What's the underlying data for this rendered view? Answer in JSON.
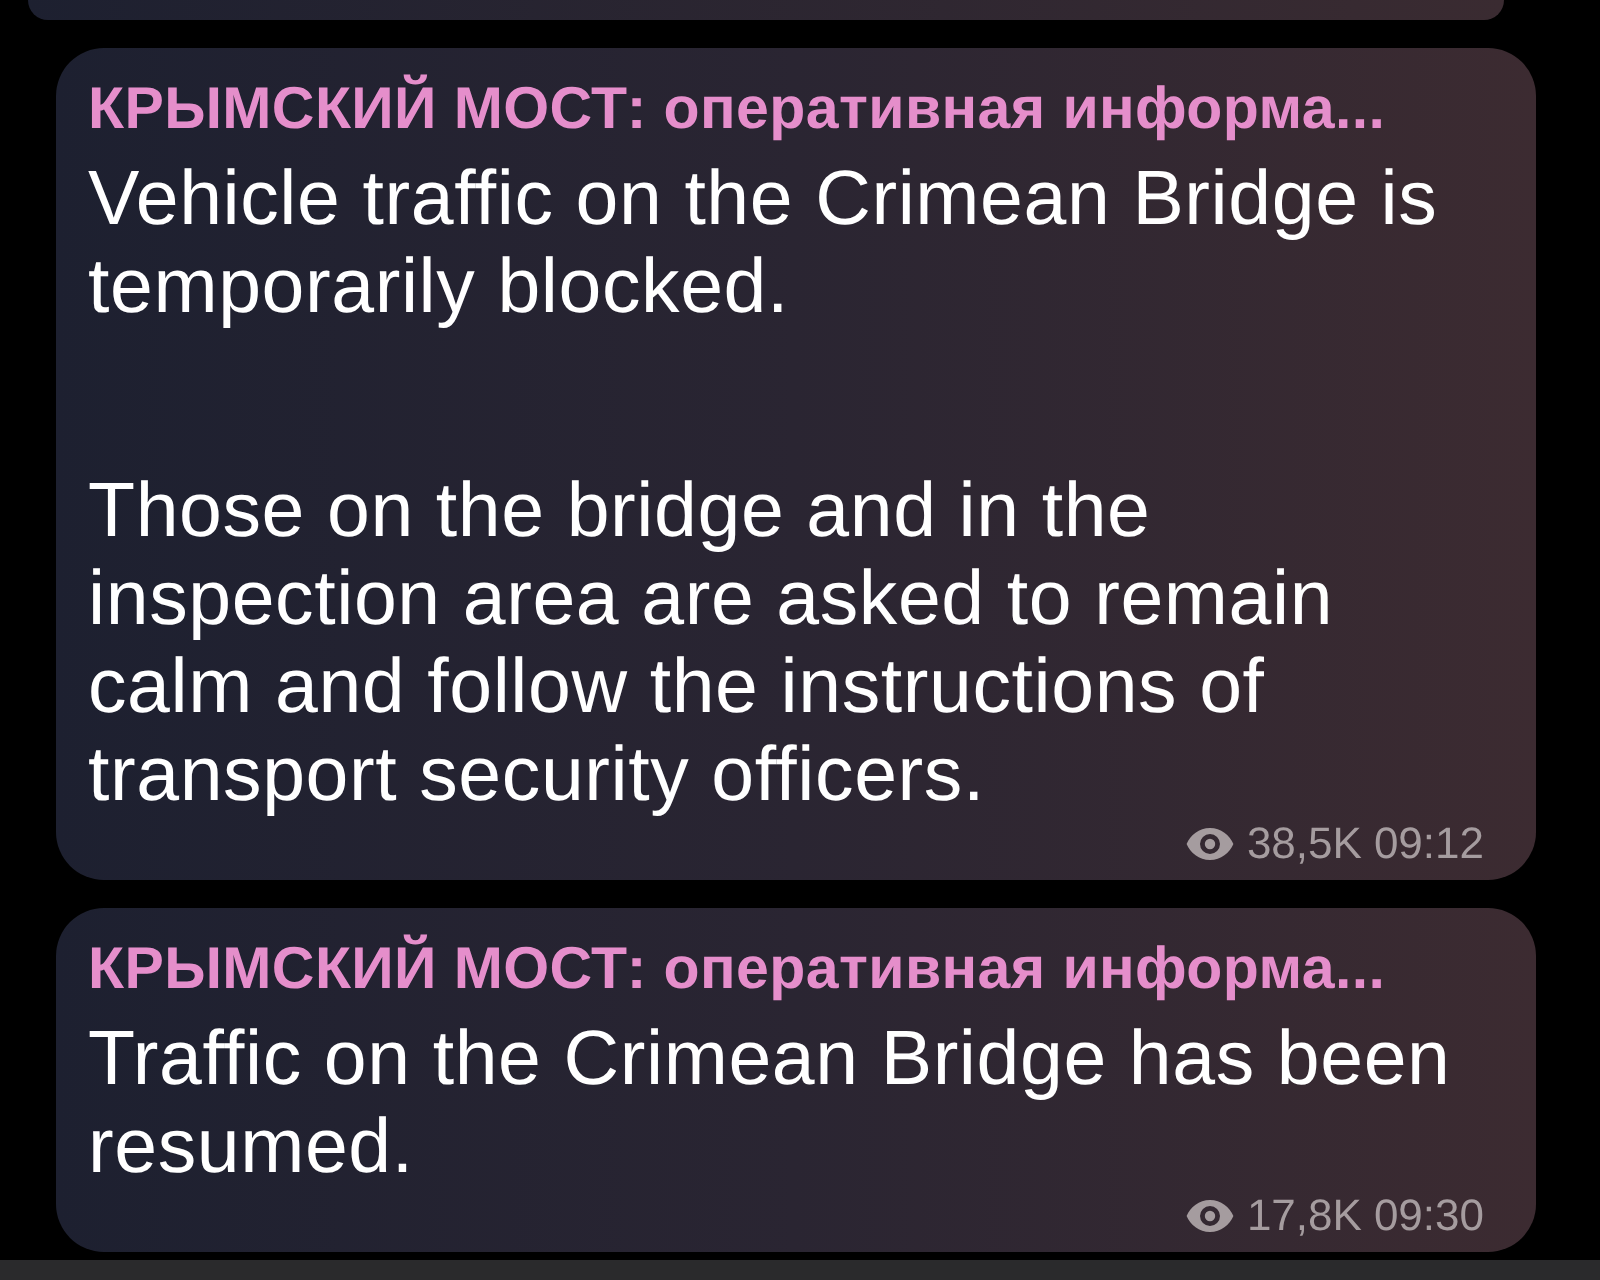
{
  "messages": [
    {
      "sender": "КРЫМСКИЙ МОСТ: оперативная информа...",
      "paragraphs": [
        "Vehicle traffic on the Crimean Bridge is temporarily blocked.",
        "Those on the bridge and in the inspection area are asked to remain calm and follow the instructions of transport security officers."
      ],
      "views": "38,5K",
      "time": "09:12"
    },
    {
      "sender": "КРЫМСКИЙ МОСТ: оперативная информа...",
      "paragraphs": [
        "Traffic on the Crimean Bridge has been resumed."
      ],
      "views": "17,8K",
      "time": "09:30"
    }
  ]
}
